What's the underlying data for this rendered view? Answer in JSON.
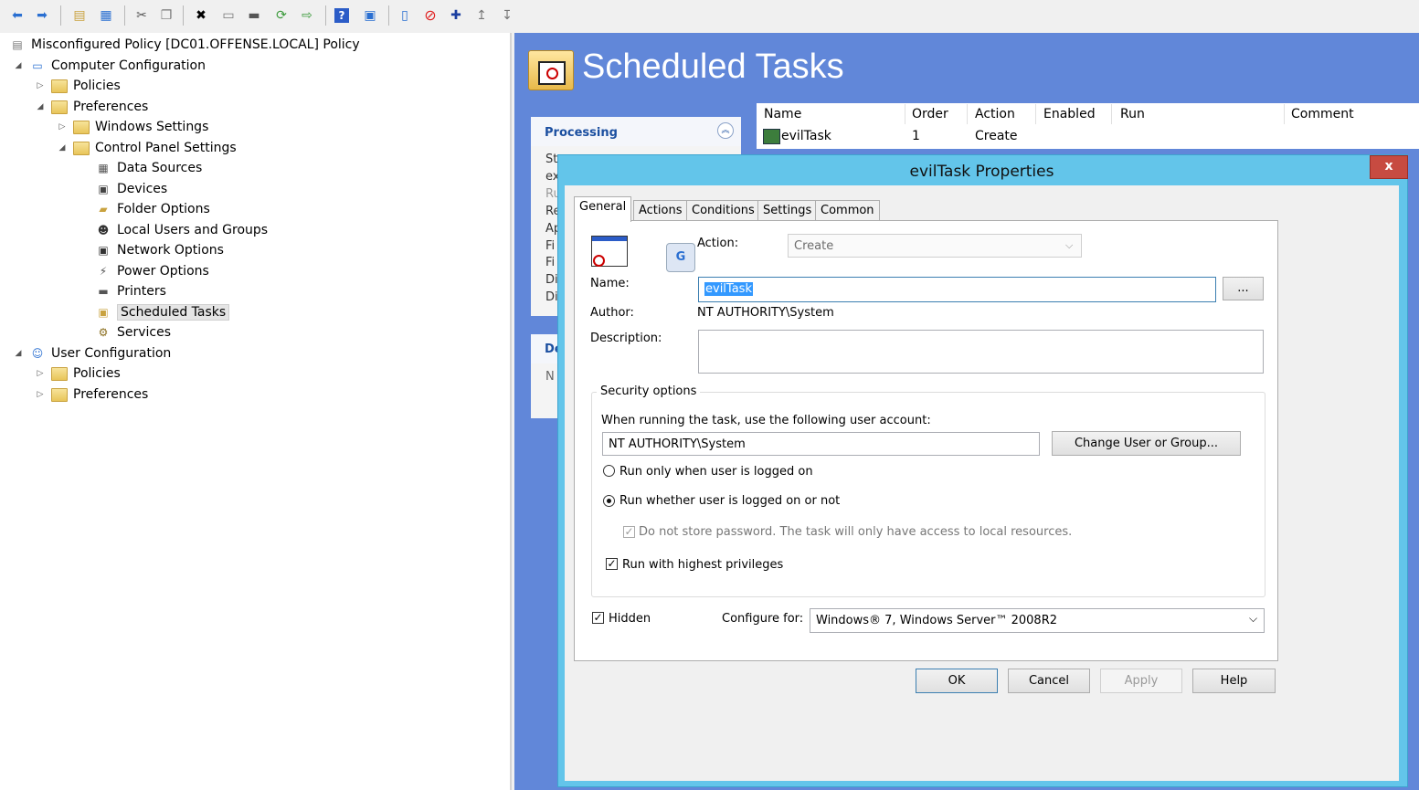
{
  "toolbar": {
    "icons": [
      "back-icon",
      "forward-icon",
      "up-folder-icon",
      "show-hide-tree-icon",
      "cut-icon",
      "copy-icon",
      "delete-icon",
      "properties-icon",
      "print-icon",
      "refresh-icon",
      "export-icon",
      "help-icon",
      "view-icon",
      "new-icon",
      "stop-icon",
      "add-icon",
      "move-up-icon",
      "move-down-icon"
    ]
  },
  "tree": {
    "root": "Misconfigured Policy [DC01.OFFENSE.LOCAL] Policy",
    "computer_config": "Computer Configuration",
    "policies": "Policies",
    "preferences": "Preferences",
    "windows_settings": "Windows Settings",
    "control_panel": "Control Panel Settings",
    "items": [
      "Data Sources",
      "Devices",
      "Folder Options",
      "Local Users and Groups",
      "Network Options",
      "Power Options",
      "Printers",
      "Scheduled Tasks",
      "Services"
    ],
    "user_config": "User Configuration",
    "user_policies": "Policies",
    "user_preferences": "Preferences"
  },
  "pane": {
    "title": "Scheduled Tasks",
    "processing_label": "Processing",
    "processing_lines": [
      "St",
      "ex",
      "Ru",
      "Re",
      "Ap",
      "Fi",
      "Fi",
      "Di",
      "Di"
    ],
    "description_label": "De",
    "description_text": "N",
    "list_headers": [
      "Name",
      "Order",
      "Action",
      "Enabled",
      "Run",
      "Comment"
    ],
    "row": {
      "name": "evilTask",
      "order": "1",
      "action": "Create"
    }
  },
  "dialog": {
    "title": "evilTask Properties",
    "close": "x",
    "tabs": [
      "General",
      "Actions",
      "Conditions",
      "Settings",
      "Common"
    ],
    "action_label": "Action:",
    "action_value": "Create",
    "name_label": "Name:",
    "name_value": "evilTask",
    "browse_label": "...",
    "author_label": "Author:",
    "author_value": "NT AUTHORITY\\System",
    "description_label": "Description:",
    "security_group": "Security options",
    "account_prompt": "When running the task, use the following user account:",
    "account_value": "NT AUTHORITY\\System",
    "change_user_button": "Change User or Group...",
    "radio_logged_on": "Run only when user is logged on",
    "radio_whether": "Run whether user is logged on or not",
    "no_store_password": "Do not store password. The task will only have access to local resources.",
    "highest_privileges": "Run with highest privileges",
    "hidden": "Hidden",
    "configure_label": "Configure for:",
    "configure_value": "Windows® 7, Windows Server™ 2008R2",
    "ok": "OK",
    "cancel": "Cancel",
    "apply": "Apply",
    "help": "Help"
  }
}
